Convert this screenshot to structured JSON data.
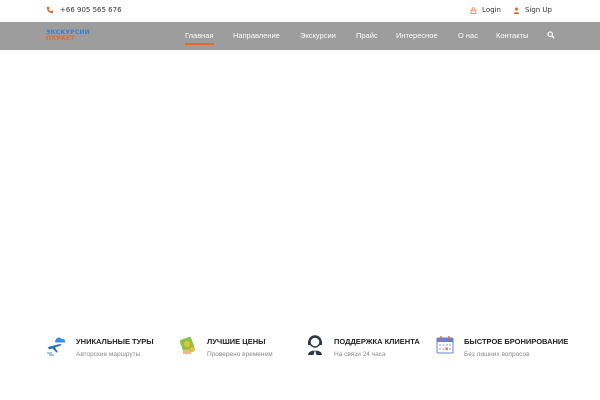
{
  "topbar": {
    "phone": "+66 905 565 676",
    "login_label": "Login",
    "signup_label": "Sign Up"
  },
  "logo": {
    "line1": "ЭКСКУРСИИ",
    "line2": "ПХУКЕТ"
  },
  "nav": {
    "items": [
      {
        "label": "Главная",
        "active": true
      },
      {
        "label": "Направление",
        "active": false
      },
      {
        "label": "Экскурсии",
        "active": false
      },
      {
        "label": "Прайс",
        "active": false
      },
      {
        "label": "Интересное",
        "active": false
      },
      {
        "label": "О нас",
        "active": false
      },
      {
        "label": "Контакты",
        "active": false
      }
    ],
    "search_icon": "search-icon"
  },
  "features": [
    {
      "icon": "airplane-cloud-icon",
      "title": "УНИКАЛЬНЫЕ ТУРЫ",
      "subtitle": "Авторские маршруты"
    },
    {
      "icon": "money-icon",
      "title": "ЛУЧШИЕ ЦЕНЫ",
      "subtitle": "Проверено временем"
    },
    {
      "icon": "support-agent-icon",
      "title": "ПОДДЕРЖКА КЛИЕНТА",
      "subtitle": "На связи 24 часа"
    },
    {
      "icon": "calendar-icon",
      "title": "БЫСТРОЕ БРОНИРОВАНИЕ",
      "subtitle": "Без лишних вопросов"
    }
  ],
  "colors": {
    "accent": "#e8682a",
    "nav_bg": "#9d9d9d",
    "logo_blue": "#3b7fd3"
  }
}
